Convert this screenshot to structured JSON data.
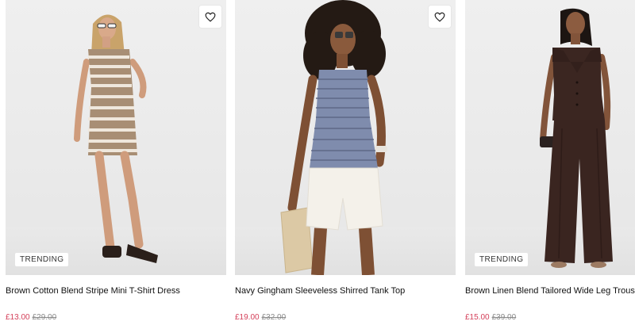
{
  "products": [
    {
      "name": "Brown Cotton Blend Stripe Mini T-Shirt Dress",
      "price_now": "£13.00",
      "price_was": "£29.00",
      "badge": "TRENDING",
      "wishlist_icon": "heart-outline-icon"
    },
    {
      "name": "Navy Gingham Sleeveless Shirred Tank Top",
      "price_now": "£19.00",
      "price_was": "£32.00",
      "badge": "",
      "wishlist_icon": "heart-outline-icon"
    },
    {
      "name": "Brown Linen Blend Tailored Wide Leg Trousers",
      "price_now": "£15.00",
      "price_was": "£39.00",
      "badge": "TRENDING",
      "wishlist_icon": ""
    }
  ],
  "colors": {
    "sale_price": "#d4405a",
    "was_price": "#8a8a8a",
    "image_background": "#ececec"
  }
}
